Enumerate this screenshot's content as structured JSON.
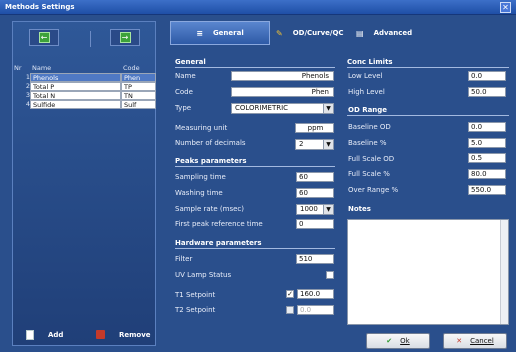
{
  "window": {
    "title": "Methods Settings",
    "close_glyph": "✕"
  },
  "left": {
    "nav_prev_glyph": "←",
    "nav_next_glyph": "→",
    "columns": {
      "nr": "Nr",
      "name": "Name",
      "code": "Code"
    },
    "rows": [
      {
        "nr": "1",
        "name": "Phenols",
        "code": "Phen"
      },
      {
        "nr": "2",
        "name": "Total P",
        "code": "TP"
      },
      {
        "nr": "3",
        "name": "Total N",
        "code": "TN"
      },
      {
        "nr": "4",
        "name": "Sulfide",
        "code": "Sulf"
      }
    ],
    "add_label": "Add",
    "remove_label": "Remove"
  },
  "tabs": [
    {
      "label": "General",
      "icon": "method-icon",
      "glyph": "≡"
    },
    {
      "label": "OD/Curve/QC",
      "icon": "pencil-icon",
      "glyph": "✎"
    },
    {
      "label": "Advanced",
      "icon": "page-icon",
      "glyph": "▤"
    }
  ],
  "general": {
    "title": "General",
    "name_label": "Name",
    "name_value": "Phenols",
    "code_label": "Code",
    "code_value": "Phen",
    "type_label": "Type",
    "type_value": "COLORIMETRIC",
    "unit_label": "Measuring unit",
    "unit_value": "ppm",
    "decimals_label": "Number of decimals",
    "decimals_value": "2"
  },
  "peaks": {
    "title": "Peaks parameters",
    "sampling_label": "Sampling time",
    "sampling_value": "60",
    "washing_label": "Washing time",
    "washing_value": "60",
    "rate_label": "Sample rate (msec)",
    "rate_value": "1000",
    "first_peak_label": "First peak reference time",
    "first_peak_value": "0"
  },
  "hardware": {
    "title": "Hardware parameters",
    "filter_label": "Filter",
    "filter_value": "510",
    "uv_label": "UV Lamp Status",
    "uv_checked": false,
    "t1_label": "T1 Setpoint",
    "t1_checked": true,
    "t1_value": "160.0",
    "t2_label": "T2 Setpoint",
    "t2_checked": false,
    "t2_value": "0.0"
  },
  "conc": {
    "title": "Conc Limits",
    "low_label": "Low Level",
    "low_value": "0.0",
    "high_label": "High Level",
    "high_value": "50.0"
  },
  "od": {
    "title": "OD Range",
    "baseline_od_label": "Baseline OD",
    "baseline_od_value": "0.0",
    "baseline_pct_label": "Baseline %",
    "baseline_pct_value": "5.0",
    "full_od_label": "Full Scale OD",
    "full_od_value": "0.5",
    "full_pct_label": "Full Scale %",
    "full_pct_value": "80.0",
    "over_label": "Over Range %",
    "over_value": "550.0"
  },
  "notes": {
    "title": "Notes",
    "value": ""
  },
  "buttons": {
    "ok_label": "Ok",
    "cancel_label": "Cancel"
  },
  "colors": {
    "window_bg": "#2a4f8c",
    "selected_row": "#4f79c4",
    "ok_icon": "#2e9a2e",
    "cancel_icon": "#c43a2a"
  }
}
